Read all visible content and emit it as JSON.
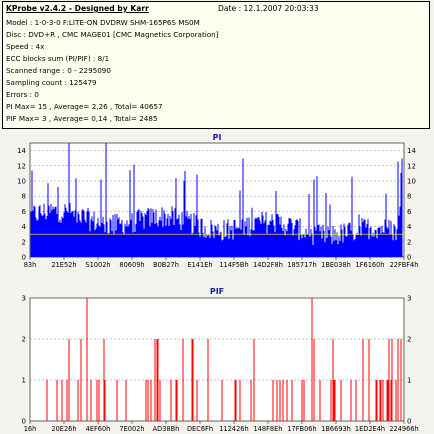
{
  "header": {
    "title": "KProbe v2.4.2 - Designed by Karr",
    "date": "Date : 12.1.2007 20:03:33",
    "lines": [
      "Model : 1-0-3-0 F:LITE-ON DVDRW SHM-165P6S MS0M",
      "Disc : DVD+R , CMC MAGE01 [CMC Magnetics Corporation]",
      "Speed : 4x",
      "ECC blocks sum (PI/PIF) : 8/1",
      "Scanned range : 0 - 2295090",
      "Sampling count : 125479",
      "Errors : 0",
      "PI Max= 15 , Average= 2,26 , Total= 40657",
      "PIF Max= 3 , Average= 0,14 , Total= 2485"
    ]
  },
  "chart_data": [
    {
      "type": "bar",
      "title": "PI",
      "ylim": [
        0,
        15
      ],
      "yticks": [
        0,
        2,
        4,
        6,
        8,
        10,
        12,
        14
      ],
      "grid": true,
      "color": "#0000ff",
      "x_tick_labels": [
        "83h",
        "21E52h",
        "S1002h",
        "80609h",
        "B0B27h",
        "E141Eh",
        "114F5Bh",
        "14D2F8h",
        "185717h",
        "1BE038h",
        "1F6160h",
        "22FBF4h"
      ],
      "max": 15,
      "average": 2.26
    },
    {
      "type": "bar",
      "title": "PIF",
      "ylim": [
        0,
        3
      ],
      "yticks": [
        0,
        1,
        2,
        3
      ],
      "grid": true,
      "color": "#ff0000",
      "x_tick_labels": [
        "16h",
        "20E26h",
        "4EF60h",
        "7E002h",
        "AD38Bh",
        "DEC6Fh",
        "112426h",
        "148F8Eh",
        "17FB06h",
        "1B6693h",
        "1ED2E4h",
        "224966h"
      ],
      "max": 3,
      "average": 0.14
    }
  ]
}
